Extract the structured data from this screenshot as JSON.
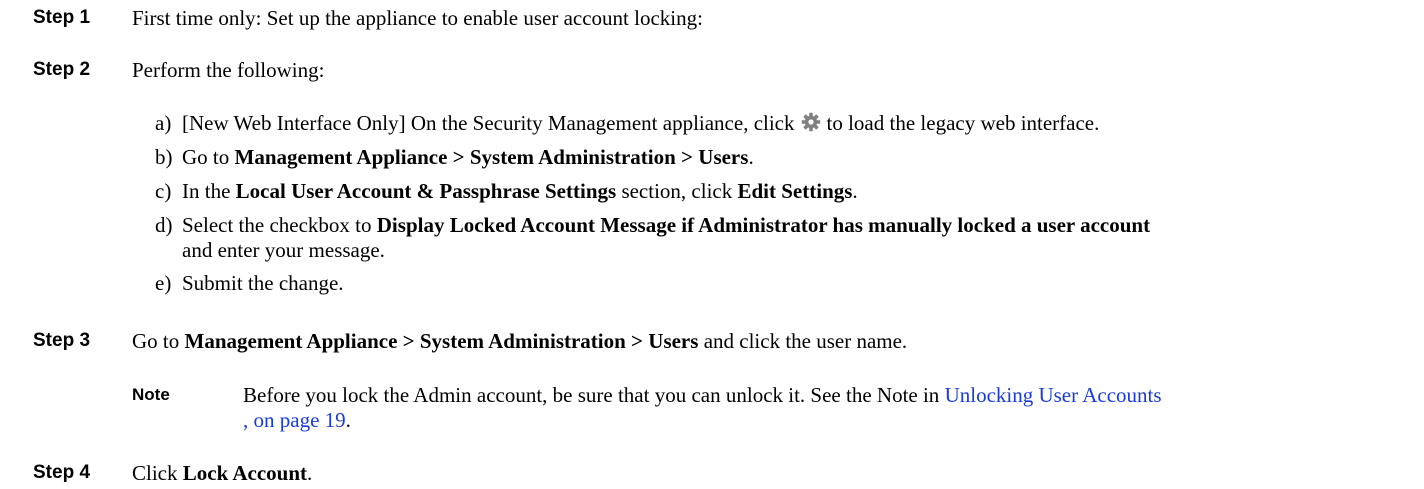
{
  "steps": [
    {
      "label": "Step 1",
      "text": "First time only: Set up the appliance to enable user account locking:"
    },
    {
      "label": "Step 2",
      "text": "Perform the following:"
    },
    {
      "label": "Step 3"
    },
    {
      "label": "Step 4"
    }
  ],
  "substeps": {
    "a": {
      "letter": "a)",
      "before": "[New Web Interface Only] On the Security Management appliance, click",
      "after": "to load the legacy web interface.",
      "icon": "gear-icon"
    },
    "b": {
      "letter": "b)",
      "prefix": "Go to ",
      "bold": "Management Appliance > System Administration > Users",
      "suffix": "."
    },
    "c": {
      "letter": "c)",
      "p1": "In the ",
      "b1": "Local User Account & Passphrase Settings",
      "p2": " section, click ",
      "b2": "Edit Settings",
      "p3": "."
    },
    "d": {
      "letter": "d)",
      "prefix": "Select the checkbox to ",
      "bold": "Display Locked Account Message if Administrator has manually locked a user account",
      "cont": "and enter your message."
    },
    "e": {
      "letter": "e)",
      "text": "Submit the change."
    }
  },
  "step3": {
    "prefix": "Go to ",
    "bold": "Management Appliance > System Administration > Users",
    "suffix": " and click the user name."
  },
  "note": {
    "label": "Note",
    "text": "Before you lock the Admin account, be sure that you can unlock it. See the Note in ",
    "link_line1": "Unlocking User Accounts",
    "link_line2": ", on page 19",
    "end": "."
  },
  "step4": {
    "prefix": "Click ",
    "bold": "Lock Account",
    "suffix": "."
  }
}
